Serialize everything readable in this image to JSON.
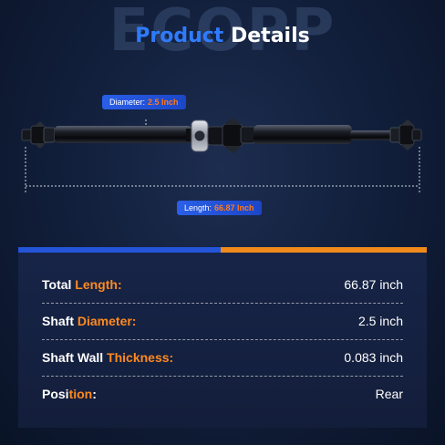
{
  "watermark": "ECOPP",
  "heading": {
    "word1": "Product",
    "word2": "Details"
  },
  "callouts": {
    "diameter_label": "Diameter:",
    "diameter_value": "2.5 Inch",
    "length_label": "Length:",
    "length_value": "66.87 Inch"
  },
  "specs": [
    {
      "label_plain": "Total ",
      "label_highlight": "Length:",
      "label_rest": "",
      "value": "66.87 inch"
    },
    {
      "label_plain": "Shaft ",
      "label_highlight": "Diameter:",
      "label_rest": "",
      "value": "2.5 inch"
    },
    {
      "label_plain": "Shaft Wall ",
      "label_highlight": "Thickness:",
      "label_rest": "",
      "value": "0.083 inch"
    },
    {
      "label_plain": "Posi",
      "label_highlight": "tion",
      "label_rest": ":",
      "value": "Rear"
    }
  ],
  "colors": {
    "background": "#12203d",
    "accent_blue": "#2454d8",
    "accent_orange": "#f08a1c",
    "highlight_text": "#ff8a1f",
    "heading_blue": "#2f7bff"
  },
  "image": {
    "subject": "drive-shaft"
  }
}
